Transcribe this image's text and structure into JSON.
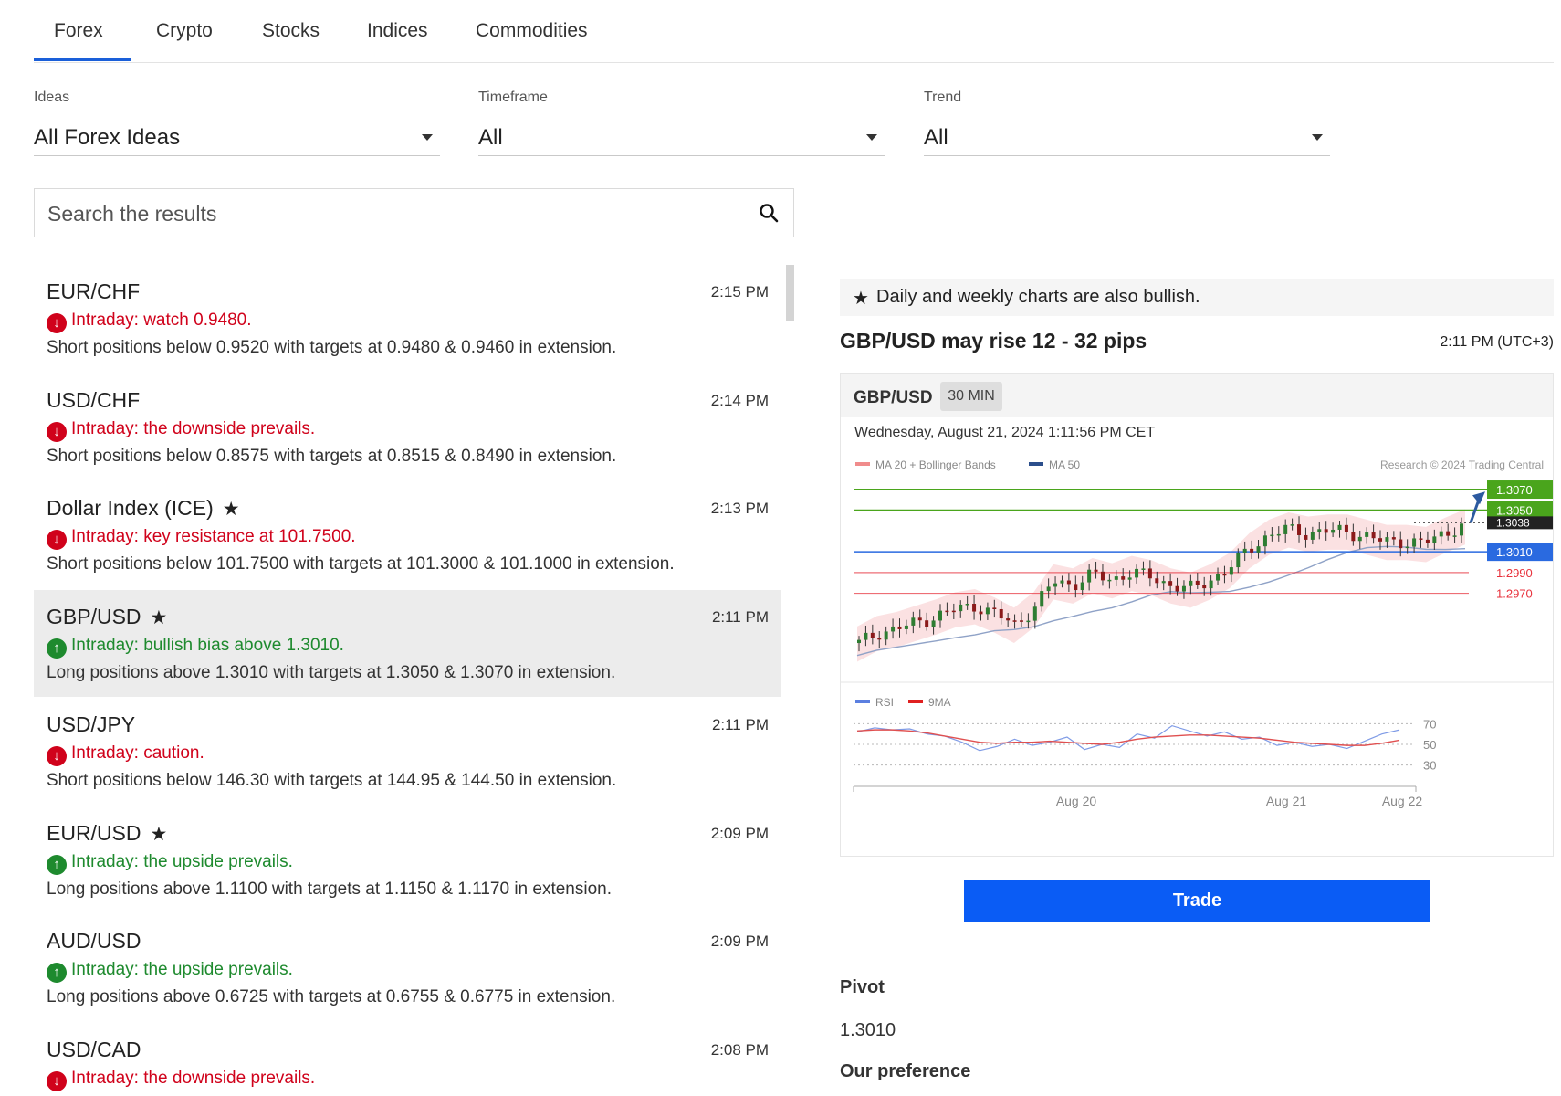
{
  "tabs": [
    "Forex",
    "Crypto",
    "Stocks",
    "Indices",
    "Commodities"
  ],
  "active_tab": "Forex",
  "filters": {
    "ideas": {
      "label": "Ideas",
      "value": "All Forex Ideas"
    },
    "timeframe": {
      "label": "Timeframe",
      "value": "All"
    },
    "trend": {
      "label": "Trend",
      "value": "All"
    }
  },
  "search": {
    "placeholder": "Search the results"
  },
  "ideas": [
    {
      "name": "EUR/CHF",
      "starred": false,
      "time": "2:15 PM",
      "direction": "down",
      "headline": "Intraday: watch 0.9480.",
      "desc": "Short positions below 0.9520 with targets at 0.9480 & 0.9460 in extension.",
      "selected": false
    },
    {
      "name": "USD/CHF",
      "starred": false,
      "time": "2:14 PM",
      "direction": "down",
      "headline": "Intraday: the downside prevails.",
      "desc": "Short positions below 0.8575 with targets at 0.8515 & 0.8490 in extension.",
      "selected": false
    },
    {
      "name": "Dollar Index (ICE)",
      "starred": true,
      "time": "2:13 PM",
      "direction": "down",
      "headline": "Intraday: key resistance at 101.7500.",
      "desc": "Short positions below 101.7500 with targets at 101.3000 & 101.1000 in extension.",
      "selected": false
    },
    {
      "name": "GBP/USD",
      "starred": true,
      "time": "2:11 PM",
      "direction": "up",
      "headline": "Intraday: bullish bias above 1.3010.",
      "desc": "Long positions above 1.3010 with targets at 1.3050 & 1.3070 in extension.",
      "selected": true
    },
    {
      "name": "USD/JPY",
      "starred": false,
      "time": "2:11 PM",
      "direction": "down",
      "headline": "Intraday: caution.",
      "desc": "Short positions below 146.30 with targets at 144.95 & 144.50 in extension.",
      "selected": false
    },
    {
      "name": "EUR/USD",
      "starred": true,
      "time": "2:09 PM",
      "direction": "up",
      "headline": "Intraday: the upside prevails.",
      "desc": "Long positions above 1.1100 with targets at 1.1150 & 1.1170 in extension.",
      "selected": false
    },
    {
      "name": "AUD/USD",
      "starred": false,
      "time": "2:09 PM",
      "direction": "up",
      "headline": "Intraday: the upside prevails.",
      "desc": "Long positions above 0.6725 with targets at 0.6755 & 0.6775 in extension.",
      "selected": false
    },
    {
      "name": "USD/CAD",
      "starred": false,
      "time": "2:08 PM",
      "direction": "down",
      "headline": "Intraday: the downside prevails.",
      "desc": "",
      "selected": false
    }
  ],
  "detail": {
    "note": "Daily and weekly charts are also bullish.",
    "title": "GBP/USD may rise 12 - 32 pips",
    "time": "2:11 PM (UTC+3)",
    "chart_symbol": "GBP/USD",
    "chart_timeframe": "30 MIN",
    "chart_datetime": "Wednesday, August 21, 2024 1:11:56 PM CET",
    "trade_label": "Trade",
    "pivot_label": "Pivot",
    "pivot_value": "1.3010",
    "preference_label": "Our preference"
  },
  "chart_data": {
    "type": "candlestick",
    "legend": [
      "MA 20 + Bollinger Bands",
      "MA 50"
    ],
    "credit": "Research © 2024 Trading Central",
    "levels": [
      {
        "value": 1.307,
        "label": "1.3070",
        "color": "#4aa51c",
        "kind": "target"
      },
      {
        "value": 1.305,
        "label": "1.3050",
        "color": "#4aa51c",
        "kind": "target"
      },
      {
        "value": 1.3038,
        "label": "1.3038",
        "color": "#222222",
        "kind": "last"
      },
      {
        "value": 1.301,
        "label": "1.3010",
        "color": "#2a6ae0",
        "kind": "pivot"
      },
      {
        "value": 1.299,
        "label": "1.2990",
        "color": "#e8323c",
        "kind": "support"
      },
      {
        "value": 1.297,
        "label": "1.2970",
        "color": "#e8323c",
        "kind": "support"
      }
    ],
    "ylim": [
      1.29,
      1.3085
    ],
    "x_ticks": [
      "Aug 20",
      "Aug 21",
      "Aug 22"
    ],
    "price_path": [
      1.2922,
      1.2932,
      1.2936,
      1.2942,
      1.2948,
      1.2955,
      1.2958,
      1.295,
      1.294,
      1.2955,
      1.2982,
      1.2978,
      1.2988,
      1.2983,
      1.299,
      1.2986,
      1.2978,
      1.2974,
      1.2982,
      1.2993,
      1.3012,
      1.3025,
      1.3032,
      1.3028,
      1.303,
      1.303,
      1.3025,
      1.302,
      1.302,
      1.3018,
      1.3027,
      1.3035
    ],
    "rsi_legend": [
      "RSI",
      "9MA"
    ],
    "rsi_levels": [
      70,
      50,
      30
    ],
    "rsi": [
      62,
      66,
      64,
      65,
      60,
      58,
      52,
      44,
      48,
      55,
      49,
      52,
      57,
      45,
      50,
      47,
      60,
      56,
      68,
      63,
      58,
      62,
      55,
      57,
      49,
      52,
      48,
      50,
      46,
      53,
      60,
      64
    ],
    "rsi_ma": [
      63,
      64,
      64,
      63,
      61,
      58,
      55,
      52,
      51,
      52,
      52,
      53,
      52,
      51,
      50,
      52,
      55,
      57,
      58,
      59,
      59,
      58,
      57,
      56,
      54,
      52,
      51,
      50,
      49,
      49,
      51,
      54
    ]
  }
}
